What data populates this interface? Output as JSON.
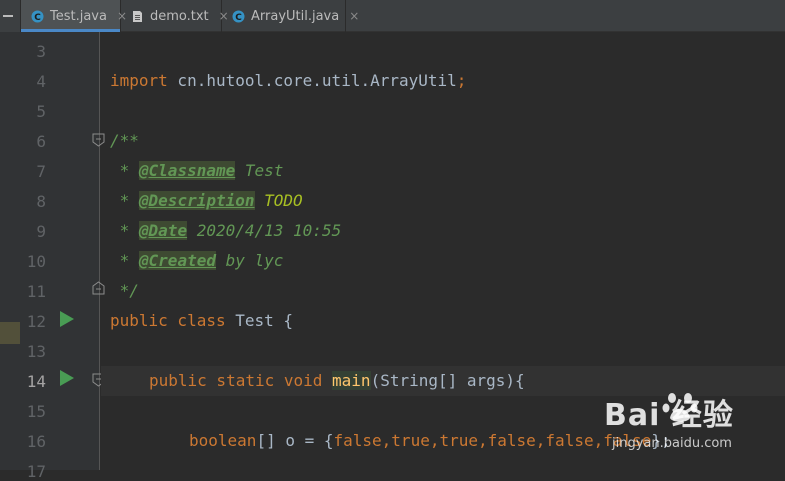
{
  "tabs": [
    {
      "label": "Test.java",
      "icon": "java-class-icon",
      "active": true
    },
    {
      "label": "demo.txt",
      "icon": "text-file-icon",
      "active": false
    },
    {
      "label": "ArrayUtil.java",
      "icon": "java-class-icon",
      "active": false
    }
  ],
  "tab_close_glyph": "×",
  "line_numbers": [
    "3",
    "4",
    "5",
    "6",
    "7",
    "8",
    "9",
    "10",
    "11",
    "12",
    "13",
    "14",
    "15",
    "16",
    "17"
  ],
  "code": {
    "l4_import": "import",
    "l4_pkg": " cn.hutool.core.util.ArrayUtil",
    "l4_semi": ";",
    "l6": "/**",
    "l7_star": " * ",
    "l7_tag": "@Classname",
    "l7_text": " Test",
    "l8_star": " * ",
    "l8_tag": "@Description",
    "l8_text": " TODO",
    "l9_star": " * ",
    "l9_tag": "@Date",
    "l9_text": " 2020/4/13 10:55",
    "l10_star": " * ",
    "l10_tag": "@Created",
    "l10_text": " by lyc",
    "l11": " */",
    "l12_kw": "public class",
    "l12_rest": " Test {",
    "l14_kw": "public static void",
    "l14_fn": "main",
    "l14_rest": "(String[] args){",
    "l16_kw": "boolean",
    "l16_mid": "[] o = {",
    "l16_vals": "false,true,true,false,false,false",
    "l16_end": "};"
  },
  "watermark": {
    "main": "Bai 经验",
    "sub": "jingyan.baidu.com"
  },
  "colors": {
    "keyword": "#cc7832",
    "doc_comment": "#629755",
    "todo": "#a8c023",
    "method": "#ffc66d",
    "text": "#a9b7c6",
    "run_icon": "#499c54",
    "active_tab_underline": "#4a88c7"
  }
}
